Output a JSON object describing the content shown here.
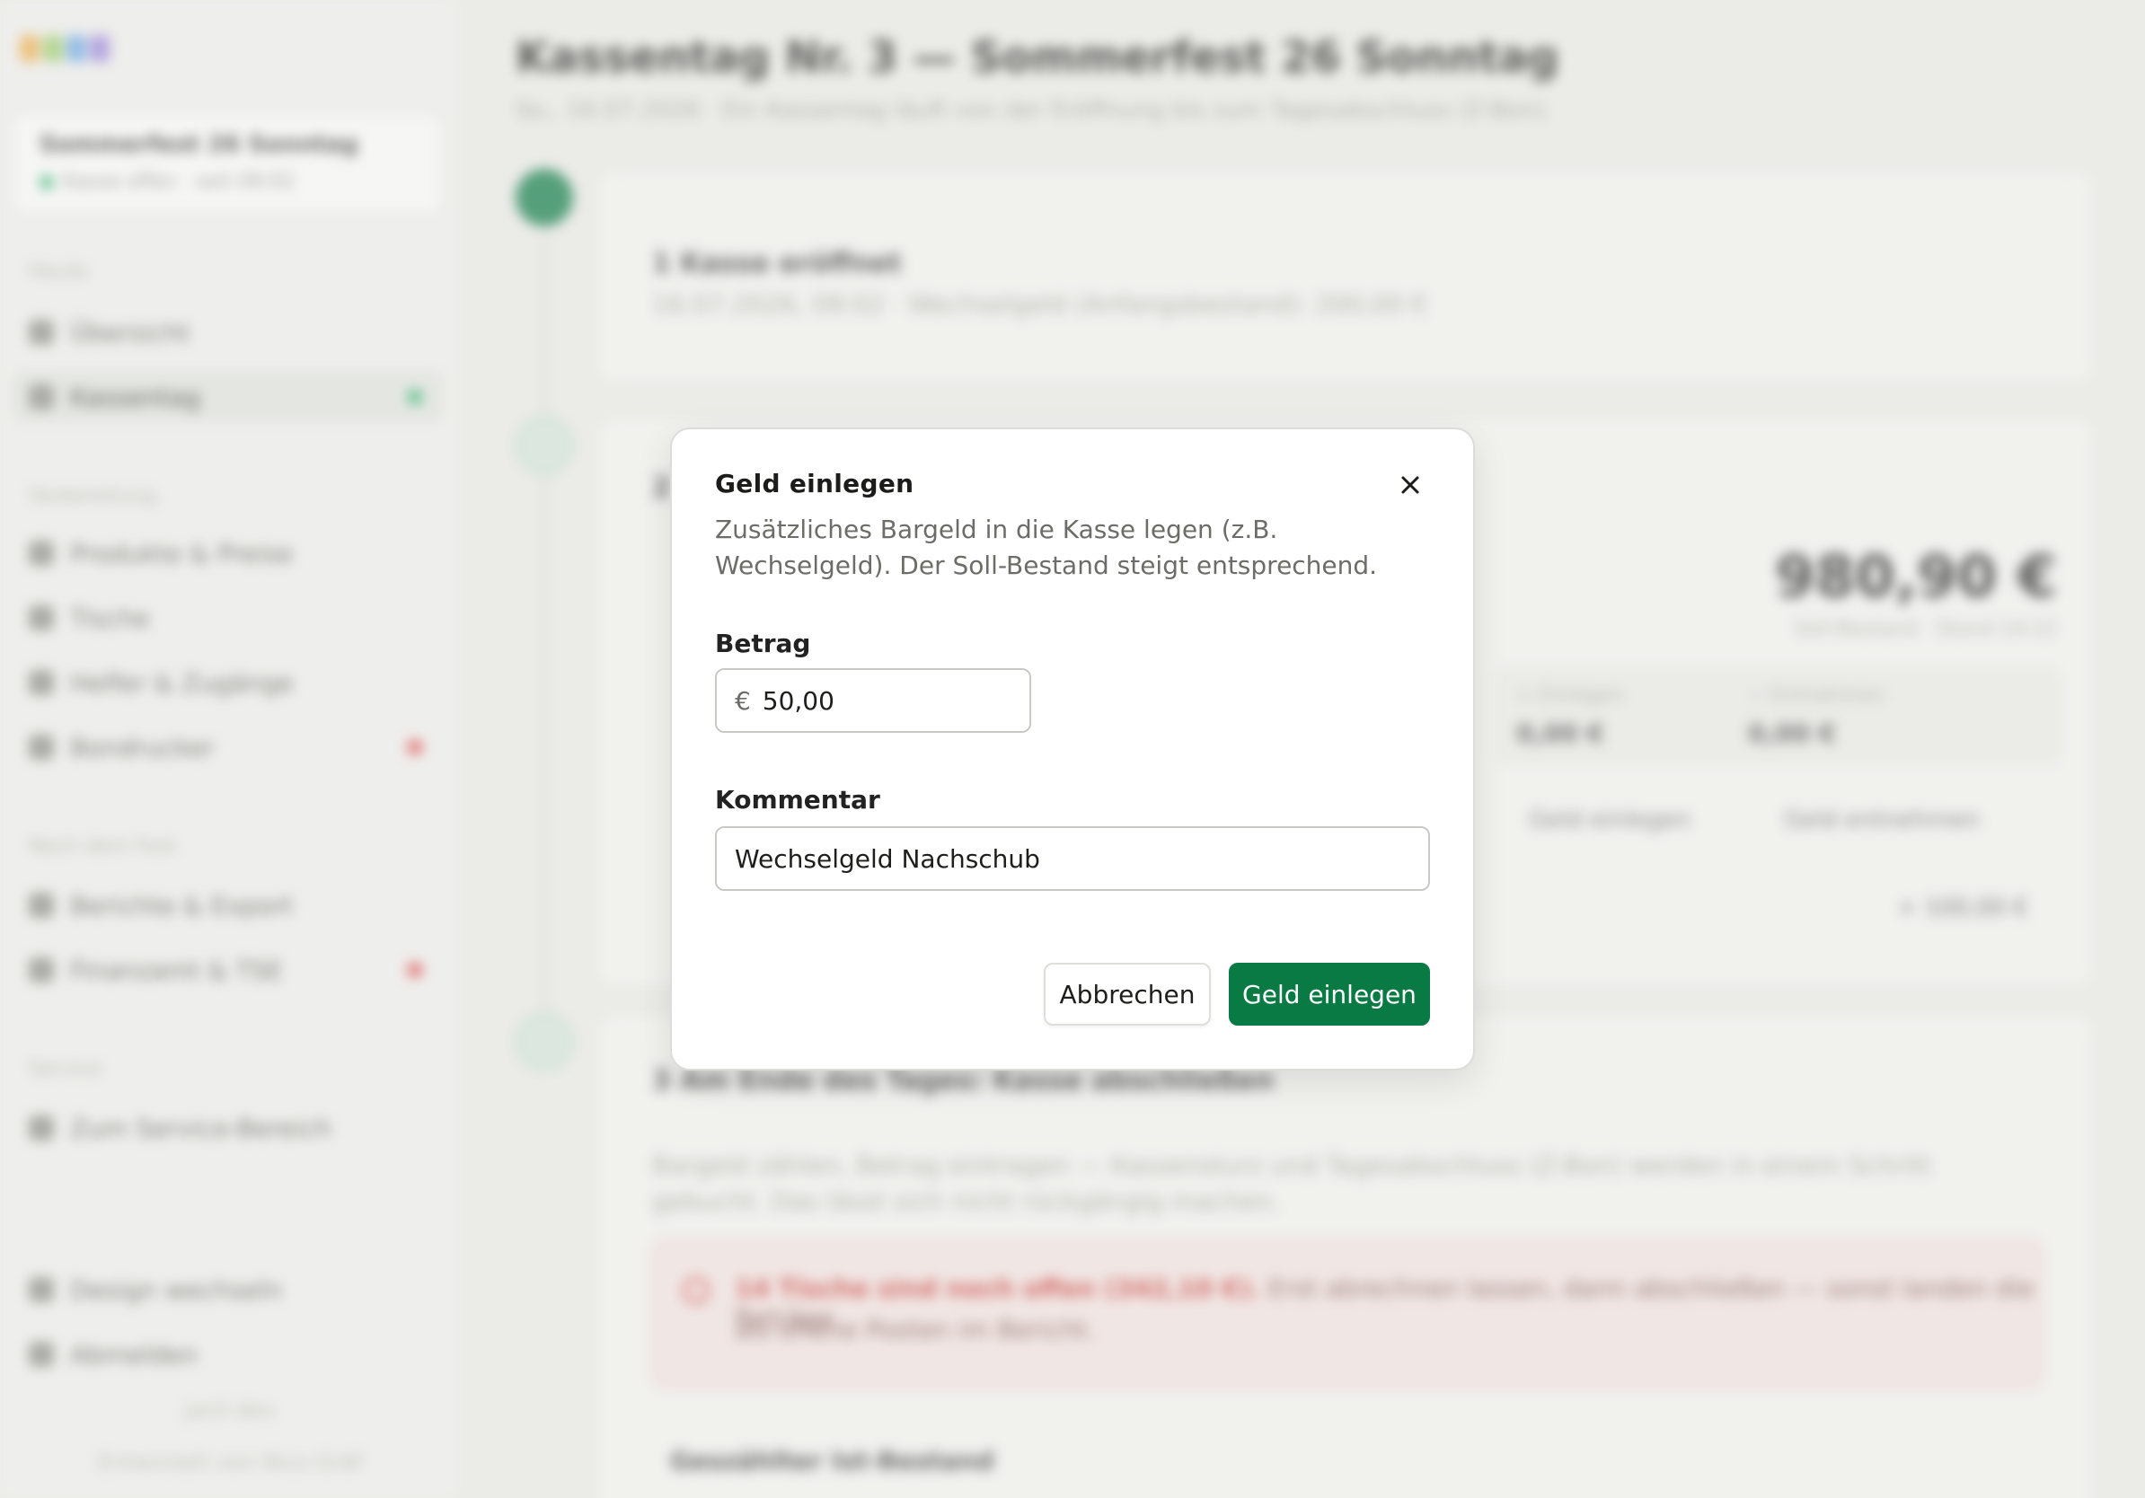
{
  "sidebar": {
    "event_name": "Sommerfest 26 Sonntag",
    "event_status": "Kasse offen · seit 09:02",
    "sections": [
      {
        "label": "Heute",
        "items": [
          {
            "label": "Übersicht",
            "active": false,
            "flag": ""
          },
          {
            "label": "Kassentag",
            "active": true,
            "flag": "#2bb36b"
          }
        ]
      },
      {
        "label": "Vorbereitung",
        "items": [
          {
            "label": "Produkte & Preise",
            "active": false,
            "flag": ""
          },
          {
            "label": "Tische",
            "active": false,
            "flag": ""
          },
          {
            "label": "Helfer & Zugänge",
            "active": false,
            "flag": ""
          },
          {
            "label": "Bondrucker",
            "active": false,
            "flag": "#e04848"
          }
        ]
      },
      {
        "label": "Nach dem Fest",
        "items": [
          {
            "label": "Berichte & Export",
            "active": false,
            "flag": ""
          },
          {
            "label": "Finanzamt & TSE",
            "active": false,
            "flag": "#e04848"
          }
        ]
      },
      {
        "label": "Service",
        "items": [
          {
            "label": "Zum Service-Bereich",
            "active": false,
            "flag": ""
          }
        ]
      }
    ],
    "footer_items": [
      {
        "label": "Design wechseln"
      },
      {
        "label": "Abmelden"
      }
    ],
    "footer_line1": "janil dev",
    "footer_line2": "Entwickelt von Nico Gräf"
  },
  "main": {
    "title": "Kassentag Nr. 3 — Sommerfest 26 Sonntag",
    "subtitle": "So., 16.07.2026 · Ein Kassentag läuft von der Eröffnung bis zum Tagesabschluss (Z-Bon).",
    "step1": {
      "title": "1  Kasse eröffnet",
      "text": "16.07.2026, 09:02 · Wechselgeld (Anfangsbestand): 200,00 €"
    },
    "step2": {
      "title": "2",
      "amount": "980,90 €",
      "amount_caption": "Soll-Bestand · Stand 14:12",
      "boxes": [
        {
          "label": "+ Einlagen",
          "value": "0,00 €"
        },
        {
          "label": "− Entnahmen",
          "value": "0,00 €"
        }
      ],
      "btn_deposit": "Geld einlegen",
      "btn_withdraw": "Geld entnehmen",
      "row_value": "+ 100,00 €"
    },
    "step3": {
      "title": "3  Am Ende des Tages: Kasse abschließen",
      "text": "Bargeld zählen, Betrag eintragen — Kassensturz und Tagesabschluss (Z-Bon) werden in einem Schritt gebucht. Das lässt sich nicht rückgängig machen.",
      "alert_bold": "14 Tische sind noch offen (342,10 €).",
      "alert_rest": " Erst abrechnen lassen, dann abschließen — sonst landen die Beträge",
      "alert_line2": "als offene Posten im Bericht.",
      "cash_heading": "Geszählter Ist-Bestand"
    }
  },
  "dialog": {
    "title": "Geld einlegen",
    "description": "Zusätzliches Bargeld in die Kasse legen (z.B. Wechselgeld). Der Soll-Bestand steigt entsprechend.",
    "amount_label": "Betrag",
    "currency_symbol": "€",
    "amount_value": "50,00",
    "comment_label": "Kommentar",
    "comment_value": "Wechselgeld Nachschub",
    "cancel_label": "Abbrechen",
    "submit_label": "Geld einlegen",
    "accent_color": "#0a7a45"
  }
}
